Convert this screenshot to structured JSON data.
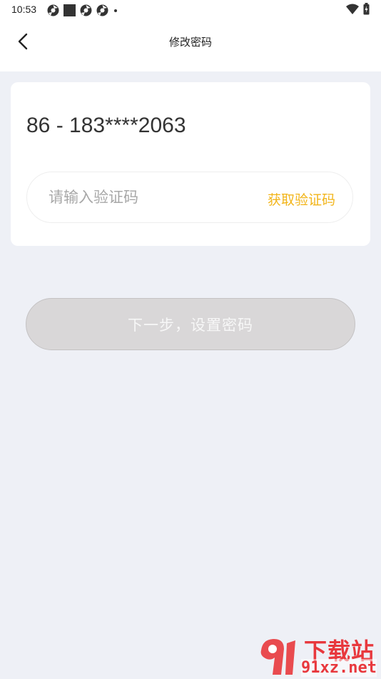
{
  "status_bar": {
    "time": "10:53"
  },
  "header": {
    "title": "修改密码"
  },
  "verification": {
    "phone_display": "86 - 183****2063",
    "code_placeholder": "请输入验证码",
    "get_code_label": "获取验证码"
  },
  "next_button": {
    "label": "下一步，设置密码"
  },
  "watermark": {
    "title": "下载站",
    "site": "91xz.net"
  },
  "colors": {
    "accent": "#f2b51a",
    "page_background": "#eef0f6",
    "disabled_button": "#d9d7d8",
    "watermark_red": "#e8383d"
  }
}
